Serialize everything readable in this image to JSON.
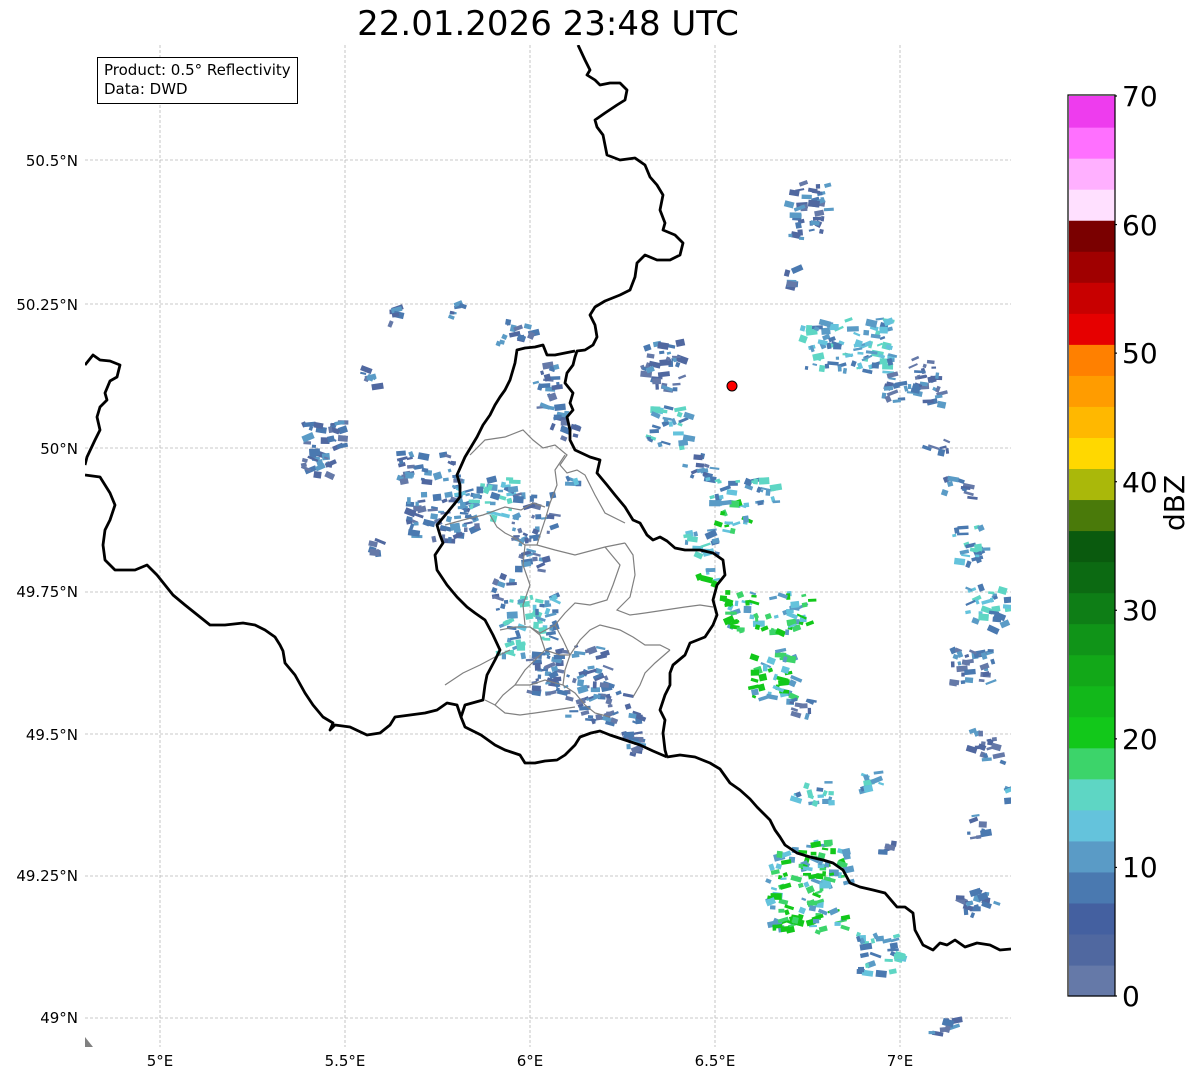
{
  "title": "22.01.2026 23:48 UTC",
  "info": {
    "product_line": "Product: 0.5° Reflectivity",
    "data_line": "Data: DWD"
  },
  "lat_ticks": [
    "50.5°N",
    "50.25°N",
    "50°N",
    "49.75°N",
    "49.5°N",
    "49.25°N",
    "49°N"
  ],
  "lon_ticks": [
    "5°E",
    "5.5°E",
    "6°E",
    "6.5°E",
    "7°E"
  ],
  "colorbar": {
    "label": "dBZ",
    "tick_labels": [
      "0",
      "10",
      "20",
      "30",
      "40",
      "50",
      "60",
      "70"
    ],
    "min": 0,
    "max": 70,
    "bin_colors": [
      "#6579a8",
      "#5068a0",
      "#4460a0",
      "#4a79b0",
      "#5a9bc6",
      "#64c3dc",
      "#5ed6c4",
      "#3cd46a",
      "#12c81a",
      "#12b81a",
      "#12a818",
      "#109418",
      "#0e7e16",
      "#0c6a12",
      "#0a5a0e",
      "#4a7a0a",
      "#aab80a",
      "#ffd800",
      "#ffb800",
      "#ff9c00",
      "#ff8000",
      "#e60000",
      "#c80000",
      "#a00000",
      "#7a0000",
      "#ffe0ff",
      "#ffb0ff",
      "#ff70ff",
      "#ee3cee"
    ]
  },
  "radar_site": {
    "color": "#ff0000"
  },
  "colors": {
    "border": "#000000",
    "district": "#808080",
    "grid": "#b0b0b0"
  }
}
